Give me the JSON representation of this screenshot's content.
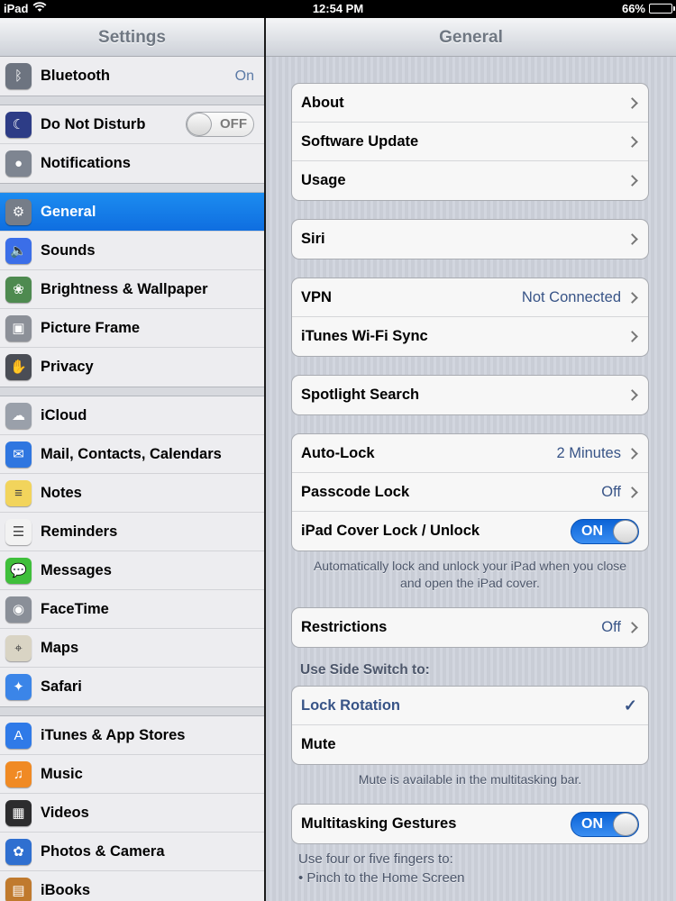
{
  "status_bar": {
    "device": "iPad",
    "wifi_icon": "wifi-icon",
    "time": "12:54 PM",
    "battery": "66%",
    "battery_level": 0.66
  },
  "master": {
    "title": "Settings",
    "groups": [
      [
        {
          "name": "bluetooth",
          "label": "Bluetooth",
          "value": "On",
          "icon": "bluetooth-icon",
          "color": "#6d7480"
        }
      ],
      [
        {
          "name": "do-not-disturb",
          "label": "Do Not Disturb",
          "toggle": "OFF",
          "icon": "moon-icon",
          "color": "#2d3c86"
        },
        {
          "name": "notifications",
          "label": "Notifications",
          "icon": "notifications-icon",
          "color": "#7e8591"
        }
      ],
      [
        {
          "name": "general",
          "label": "General",
          "icon": "gear-icon",
          "color": "#767d88",
          "selected": true
        },
        {
          "name": "sounds",
          "label": "Sounds",
          "icon": "speaker-icon",
          "color": "#3b6ee8"
        },
        {
          "name": "brightness-wallpaper",
          "label": "Brightness & Wallpaper",
          "icon": "flower-icon",
          "color": "#4e8a50"
        },
        {
          "name": "picture-frame",
          "label": "Picture Frame",
          "icon": "picture-frame-icon",
          "color": "#8c9098"
        },
        {
          "name": "privacy",
          "label": "Privacy",
          "icon": "hand-icon",
          "color": "#4a4d55"
        }
      ],
      [
        {
          "name": "icloud",
          "label": "iCloud",
          "icon": "cloud-icon",
          "color": "#9aa0aa"
        },
        {
          "name": "mail-contacts-calendars",
          "label": "Mail, Contacts, Calendars",
          "icon": "mail-icon",
          "color": "#2f76e0"
        },
        {
          "name": "notes",
          "label": "Notes",
          "icon": "notes-icon",
          "color": "#f2d45c"
        },
        {
          "name": "reminders",
          "label": "Reminders",
          "icon": "reminders-icon",
          "color": "#f2f2f2"
        },
        {
          "name": "messages",
          "label": "Messages",
          "icon": "message-bubble-icon",
          "color": "#3fbf3b"
        },
        {
          "name": "facetime",
          "label": "FaceTime",
          "icon": "camera-icon",
          "color": "#8a8f98"
        },
        {
          "name": "maps",
          "label": "Maps",
          "icon": "map-icon",
          "color": "#d9d4c4"
        },
        {
          "name": "safari",
          "label": "Safari",
          "icon": "compass-icon",
          "color": "#3b85e8"
        }
      ],
      [
        {
          "name": "itunes-app-stores",
          "label": "iTunes & App Stores",
          "icon": "app-store-icon",
          "color": "#2f7ae8"
        },
        {
          "name": "music",
          "label": "Music",
          "icon": "music-note-icon",
          "color": "#f08a24"
        },
        {
          "name": "videos",
          "label": "Videos",
          "icon": "clapperboard-icon",
          "color": "#2c2c2e"
        },
        {
          "name": "photos-camera",
          "label": "Photos & Camera",
          "icon": "sunflower-icon",
          "color": "#2f6fd0"
        },
        {
          "name": "ibooks",
          "label": "iBooks",
          "icon": "book-icon",
          "color": "#c07a2e"
        }
      ]
    ]
  },
  "detail": {
    "title": "General",
    "groups": [
      {
        "rows": [
          {
            "name": "about",
            "label": "About"
          },
          {
            "name": "software-update",
            "label": "Software Update"
          },
          {
            "name": "usage",
            "label": "Usage"
          }
        ]
      },
      {
        "rows": [
          {
            "name": "siri",
            "label": "Siri"
          }
        ]
      },
      {
        "rows": [
          {
            "name": "vpn",
            "label": "VPN",
            "value": "Not Connected"
          },
          {
            "name": "itunes-wifi-sync",
            "label": "iTunes Wi-Fi Sync"
          }
        ]
      },
      {
        "rows": [
          {
            "name": "spotlight-search",
            "label": "Spotlight Search"
          }
        ]
      },
      {
        "rows": [
          {
            "name": "auto-lock",
            "label": "Auto-Lock",
            "value": "2 Minutes"
          },
          {
            "name": "passcode-lock",
            "label": "Passcode Lock",
            "value": "Off"
          },
          {
            "name": "ipad-cover-lock",
            "label": "iPad Cover Lock / Unlock",
            "toggle": "ON"
          }
        ],
        "footer": "Automatically lock and unlock your iPad when you close and open the iPad cover."
      },
      {
        "rows": [
          {
            "name": "restrictions",
            "label": "Restrictions",
            "value": "Off"
          }
        ]
      },
      {
        "header": "Use Side Switch to:",
        "rows": [
          {
            "name": "lock-rotation",
            "label": "Lock Rotation",
            "checked": true
          },
          {
            "name": "mute",
            "label": "Mute",
            "plain": true
          }
        ],
        "footer": "Mute is available in the multitasking bar."
      },
      {
        "rows": [
          {
            "name": "multitasking-gestures",
            "label": "Multitasking Gestures",
            "toggle": "ON"
          }
        ]
      }
    ],
    "bottom_text": [
      "Use four or five fingers to:",
      "• Pinch to the Home Screen"
    ]
  }
}
